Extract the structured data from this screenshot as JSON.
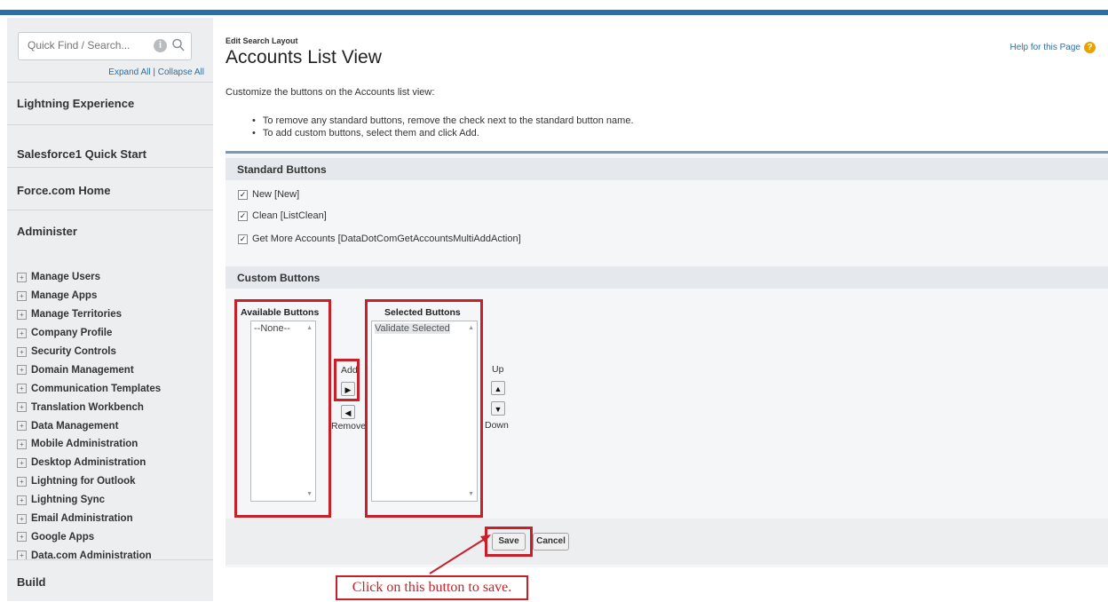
{
  "colors": {
    "accent": "#2a6fa8",
    "highlight": "#c8202a",
    "help_icon": "#e8a200"
  },
  "sidebar": {
    "search_placeholder": "Quick Find / Search...",
    "expand_all": "Expand All",
    "separator": "|",
    "collapse_all": "Collapse All",
    "sections": {
      "lightning": "Lightning Experience",
      "salesforce1": "Salesforce1 Quick Start",
      "forcecom": "Force.com Home",
      "administer": "Administer",
      "build": "Build"
    },
    "admin_items": [
      "Manage Users",
      "Manage Apps",
      "Manage Territories",
      "Company Profile",
      "Security Controls",
      "Domain Management",
      "Communication Templates",
      "Translation Workbench",
      "Data Management",
      "Mobile Administration",
      "Desktop Administration",
      "Lightning for Outlook",
      "Lightning Sync",
      "Email Administration",
      "Google Apps",
      "Data.com Administration"
    ]
  },
  "header": {
    "breadcrumb": "Edit Search Layout",
    "title": "Accounts List View",
    "help": "Help for this Page"
  },
  "intro": {
    "text": "Customize the buttons on the Accounts list view:",
    "bullets": [
      "To remove any standard buttons, remove the check next to the standard button name.",
      "To add custom buttons, select them and click Add."
    ]
  },
  "standard": {
    "heading": "Standard Buttons",
    "items": [
      "New [New]",
      "Clean [ListClean]",
      "Get More Accounts [DataDotComGetAccountsMultiAddAction]"
    ]
  },
  "custom": {
    "heading": "Custom Buttons",
    "available_label": "Available Buttons",
    "available_option": "--None--",
    "selected_label": "Selected Buttons",
    "selected_option": "Validate Selected",
    "add_label": "Add",
    "remove_label": "Remove",
    "up_label": "Up",
    "down_label": "Down"
  },
  "footer": {
    "save": "Save",
    "cancel": "Cancel"
  },
  "callout": "Click on this button to save."
}
